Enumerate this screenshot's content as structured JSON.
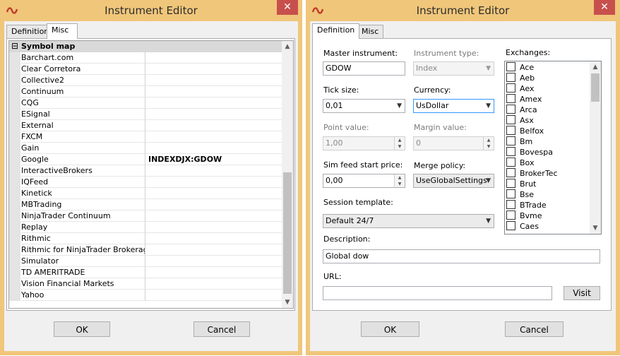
{
  "window_left": {
    "title": "Instrument Editor",
    "close_glyph": "✕",
    "tabs": [
      {
        "label": "Definition",
        "active": false
      },
      {
        "label": "Misc",
        "active": true
      }
    ],
    "category_glyph": "⊟",
    "category": "Symbol map",
    "rows": [
      {
        "name": "Barchart.com",
        "value": ""
      },
      {
        "name": "Clear Corretora",
        "value": ""
      },
      {
        "name": "Collective2",
        "value": ""
      },
      {
        "name": "Continuum",
        "value": ""
      },
      {
        "name": "CQG",
        "value": ""
      },
      {
        "name": "ESignal",
        "value": ""
      },
      {
        "name": "External",
        "value": ""
      },
      {
        "name": "FXCM",
        "value": ""
      },
      {
        "name": "Gain",
        "value": ""
      },
      {
        "name": "Google",
        "value": "INDEXDJX:GDOW"
      },
      {
        "name": "InteractiveBrokers",
        "value": ""
      },
      {
        "name": "IQFeed",
        "value": ""
      },
      {
        "name": "Kinetick",
        "value": ""
      },
      {
        "name": "MBTrading",
        "value": ""
      },
      {
        "name": "NinjaTrader Continuum",
        "value": ""
      },
      {
        "name": "Replay",
        "value": ""
      },
      {
        "name": "Rithmic",
        "value": ""
      },
      {
        "name": "Rithmic for NinjaTrader Brokerage",
        "value": ""
      },
      {
        "name": "Simulator",
        "value": ""
      },
      {
        "name": "TD AMERITRADE",
        "value": ""
      },
      {
        "name": "Vision Financial Markets",
        "value": ""
      },
      {
        "name": "Yahoo",
        "value": ""
      }
    ],
    "ok_label": "OK",
    "cancel_label": "Cancel"
  },
  "window_right": {
    "title": "Instrument Editor",
    "close_glyph": "✕",
    "tabs": [
      {
        "label": "Definition",
        "active": true
      },
      {
        "label": "Misc",
        "active": false
      }
    ],
    "master_instrument": {
      "label": "Master instrument:",
      "value": "GDOW"
    },
    "instrument_type": {
      "label": "Instrument type:",
      "value": "Index"
    },
    "tick_size": {
      "label": "Tick size:",
      "value": "0,01"
    },
    "currency": {
      "label": "Currency:",
      "value": "UsDollar"
    },
    "point_value": {
      "label": "Point value:",
      "value": "1,00"
    },
    "margin_value": {
      "label": "Margin value:",
      "value": "0"
    },
    "sim_feed": {
      "label": "Sim feed start price:",
      "value": "0,00"
    },
    "merge_policy": {
      "label": "Merge policy:",
      "value": "UseGlobalSettings"
    },
    "session_template": {
      "label": "Session template:",
      "value": "Default 24/7"
    },
    "description": {
      "label": "Description:",
      "value": "Global dow"
    },
    "url": {
      "label": "URL:",
      "value": ""
    },
    "visit_label": "Visit",
    "exchanges_label": "Exchanges:",
    "exchanges": [
      "Ace",
      "Aeb",
      "Aex",
      "Amex",
      "Arca",
      "Asx",
      "Belfox",
      "Bm",
      "Bovespa",
      "Box",
      "BrokerTec",
      "Brut",
      "Bse",
      "BTrade",
      "Bvme",
      "Caes"
    ],
    "ok_label": "OK",
    "cancel_label": "Cancel"
  },
  "icons": {
    "app": "ninjatrader-logo-icon",
    "dropdown": "chevron-down-icon",
    "scroll_up": "scroll-up-icon",
    "scroll_down": "scroll-down-icon"
  },
  "colors": {
    "frame": "#f0c67a",
    "close": "#c7504d",
    "focus_border": "#3399ff"
  }
}
